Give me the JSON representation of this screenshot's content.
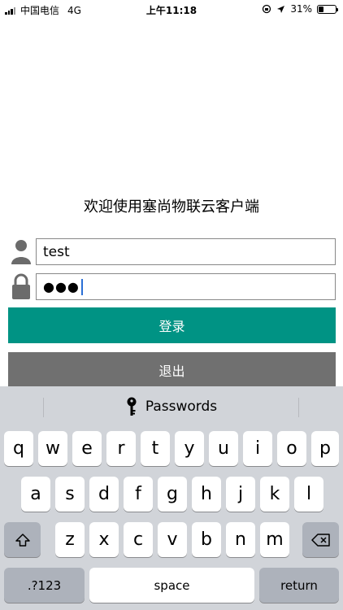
{
  "status_bar": {
    "carrier": "中国电信",
    "network": "4G",
    "time": "上午11:18",
    "battery_percent": "31%",
    "battery_level": 0.31
  },
  "welcome_text": "欢迎使用塞尚物联云客户端",
  "form": {
    "username_value": "test",
    "password_masked": "●●●"
  },
  "buttons": {
    "login_label": "登录",
    "exit_label": "退出"
  },
  "keyboard": {
    "suggestion_label": "Passwords",
    "row1": [
      "q",
      "w",
      "e",
      "r",
      "t",
      "y",
      "u",
      "i",
      "o",
      "p"
    ],
    "row2": [
      "a",
      "s",
      "d",
      "f",
      "g",
      "h",
      "j",
      "k",
      "l"
    ],
    "row3": [
      "z",
      "x",
      "c",
      "v",
      "b",
      "n",
      "m"
    ],
    "numbers_label": ".?123",
    "space_label": "space",
    "return_label": "return"
  },
  "colors": {
    "login_button": "#009384",
    "exit_button": "#707070",
    "keyboard_bg": "#d1d4d9"
  }
}
